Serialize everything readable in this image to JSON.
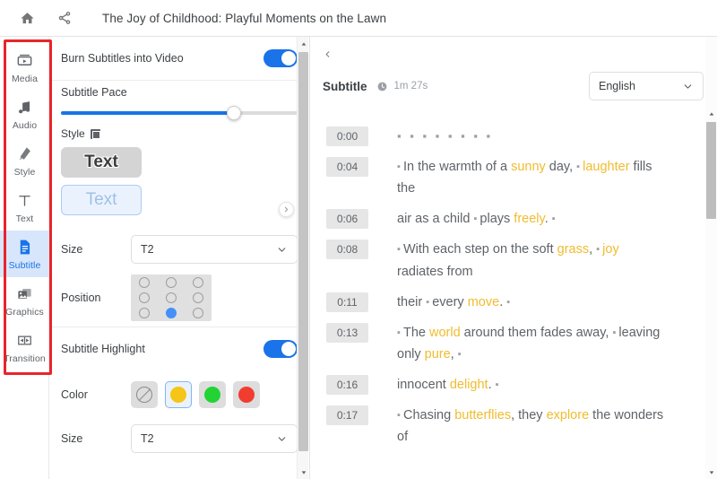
{
  "topbar": {
    "home_icon": "home-icon",
    "share_icon": "share-icon",
    "title": "The Joy of Childhood: Playful Moments on the Lawn"
  },
  "sidebar": {
    "items": [
      {
        "label": "Media",
        "icon": "media-icon",
        "active": false
      },
      {
        "label": "Audio",
        "icon": "audio-note-icon",
        "active": false
      },
      {
        "label": "Style",
        "icon": "style-icon",
        "active": false
      },
      {
        "label": "Text",
        "icon": "text-t-icon",
        "active": false
      },
      {
        "label": "Subtitle",
        "icon": "subtitle-doc-icon",
        "active": true
      },
      {
        "label": "Graphics",
        "icon": "graphics-image-icon",
        "active": false
      },
      {
        "label": "Transition",
        "icon": "transition-icon",
        "active": false
      }
    ]
  },
  "settings": {
    "burn_subtitles": {
      "label": "Burn Subtitles into Video",
      "enabled": true
    },
    "subtitle_pace": {
      "label": "Subtitle Pace",
      "value_percent": 73
    },
    "style": {
      "label": "Style",
      "options": [
        {
          "sample_text": "Text",
          "selected": true
        },
        {
          "sample_text": "Text",
          "selected": false
        }
      ]
    },
    "size": {
      "label": "Size",
      "value": "T2"
    },
    "position": {
      "label": "Position",
      "selected_index": 7,
      "cells": 9
    },
    "subtitle_highlight": {
      "label": "Subtitle Highlight",
      "enabled": true
    },
    "color": {
      "label": "Color",
      "swatches": [
        {
          "name": "none",
          "hex": "",
          "selected": false
        },
        {
          "name": "yellow",
          "hex": "#f5c518",
          "selected": true
        },
        {
          "name": "green",
          "hex": "#22d433",
          "selected": false
        },
        {
          "name": "red",
          "hex": "#f03d2f",
          "selected": false
        }
      ]
    },
    "highlight_size": {
      "label": "Size",
      "value": "T2"
    },
    "expand_icon": "chevron-right-icon"
  },
  "subtitle_panel": {
    "collapse_icon": "chevron-left-icon",
    "title": "Subtitle",
    "clock_icon": "clock-icon",
    "duration": "1m 27s",
    "language": {
      "value": "English",
      "chevron": "chevron-down-icon"
    },
    "cues": [
      {
        "time": "0:00",
        "segments": [
          {
            "t": "▪ ▪ ▪ ▪ ▪ ▪ ▪ ▪",
            "k": "dots"
          }
        ]
      },
      {
        "time": "0:04",
        "segments": [
          {
            "t": "▪ ",
            "k": "sep"
          },
          {
            "t": "In the warmth of a ",
            "k": "plain"
          },
          {
            "t": "sunny",
            "k": "hl"
          },
          {
            "t": " day, ",
            "k": "plain"
          },
          {
            "t": "▪ ",
            "k": "sep"
          },
          {
            "t": "laughter",
            "k": "hl"
          },
          {
            "t": " fills the",
            "k": "plain"
          }
        ]
      },
      {
        "time": "0:06",
        "segments": [
          {
            "t": "air as a child ",
            "k": "plain"
          },
          {
            "t": "▪ ",
            "k": "sep"
          },
          {
            "t": "plays ",
            "k": "plain"
          },
          {
            "t": "freely",
            "k": "hl"
          },
          {
            "t": ". ",
            "k": "plain"
          },
          {
            "t": "▪",
            "k": "sep"
          }
        ]
      },
      {
        "time": "0:08",
        "segments": [
          {
            "t": "▪ ",
            "k": "sep"
          },
          {
            "t": "With each step on the soft ",
            "k": "plain"
          },
          {
            "t": "grass",
            "k": "hl"
          },
          {
            "t": ", ",
            "k": "plain"
          },
          {
            "t": "▪ ",
            "k": "sep"
          },
          {
            "t": "joy",
            "k": "hl"
          },
          {
            "t": " radiates from",
            "k": "plain"
          }
        ]
      },
      {
        "time": "0:11",
        "segments": [
          {
            "t": "their ",
            "k": "plain"
          },
          {
            "t": "▪ ",
            "k": "sep"
          },
          {
            "t": "every ",
            "k": "plain"
          },
          {
            "t": "move",
            "k": "hl"
          },
          {
            "t": ". ",
            "k": "plain"
          },
          {
            "t": "▪",
            "k": "sep"
          }
        ]
      },
      {
        "time": "0:13",
        "segments": [
          {
            "t": "▪ ",
            "k": "sep"
          },
          {
            "t": "The ",
            "k": "plain"
          },
          {
            "t": "world",
            "k": "hl"
          },
          {
            "t": " around them fades away, ",
            "k": "plain"
          },
          {
            "t": "▪ ",
            "k": "sep"
          },
          {
            "t": "leaving only ",
            "k": "plain"
          },
          {
            "t": "pure",
            "k": "hl"
          },
          {
            "t": ", ",
            "k": "plain"
          },
          {
            "t": "▪",
            "k": "sep"
          }
        ]
      },
      {
        "time": "0:16",
        "segments": [
          {
            "t": "innocent ",
            "k": "plain"
          },
          {
            "t": "delight",
            "k": "hl"
          },
          {
            "t": ". ",
            "k": "plain"
          },
          {
            "t": "▪",
            "k": "sep"
          }
        ]
      },
      {
        "time": "0:17",
        "segments": [
          {
            "t": "▪ ",
            "k": "sep"
          },
          {
            "t": "Chasing ",
            "k": "plain"
          },
          {
            "t": "butterflies",
            "k": "hl"
          },
          {
            "t": ", they ",
            "k": "plain"
          },
          {
            "t": "explore",
            "k": "hl"
          },
          {
            "t": " the wonders of",
            "k": "plain"
          }
        ]
      }
    ]
  },
  "colors": {
    "accent_blue": "#1a73e8",
    "highlight_yellow": "#f0bc2e",
    "annotation_red": "#e8252a"
  }
}
